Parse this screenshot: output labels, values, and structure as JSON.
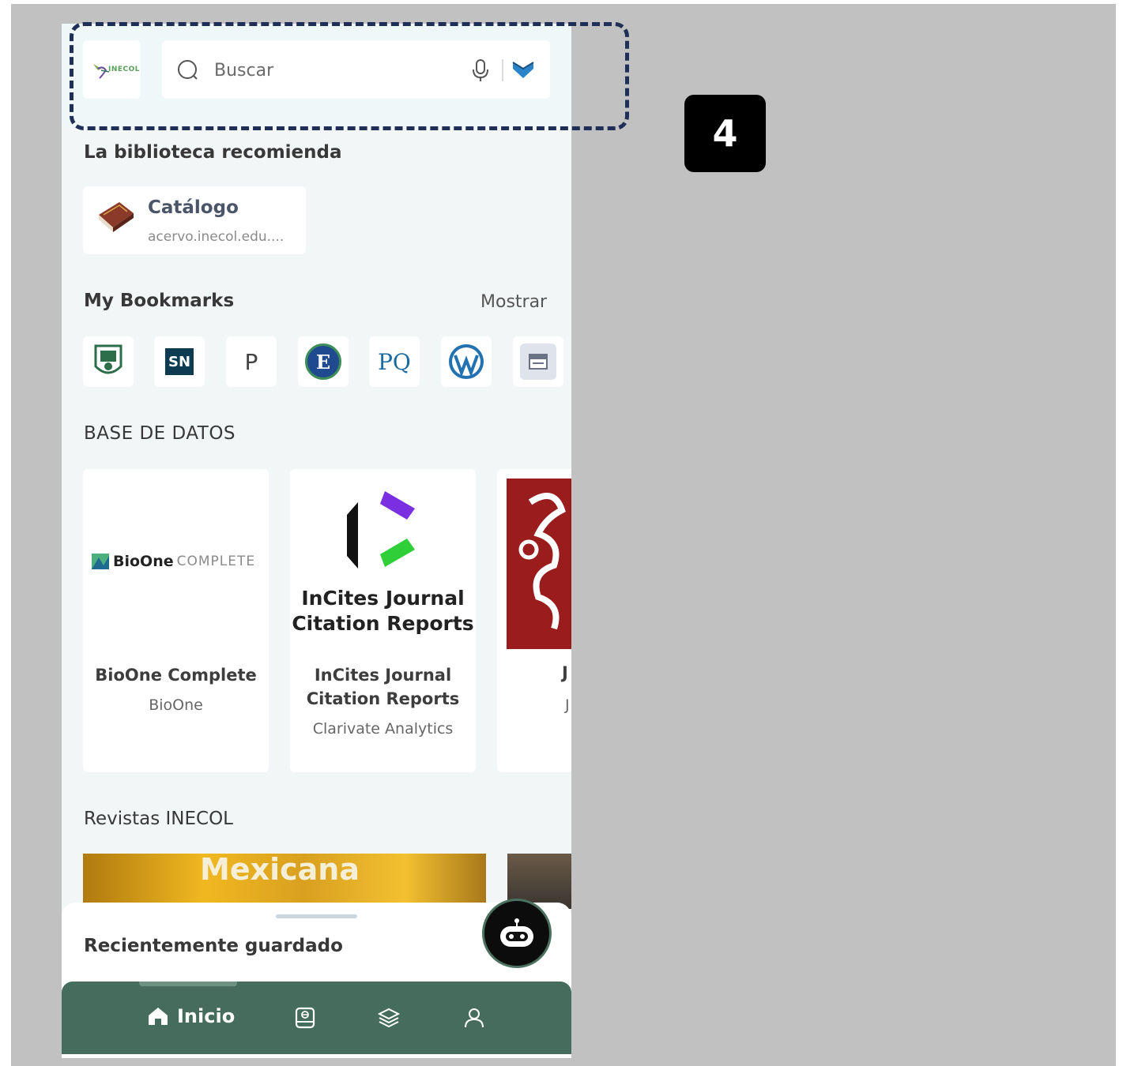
{
  "header": {
    "logo_text": "INECOL",
    "search_placeholder": "Buscar"
  },
  "recommend": {
    "title": "La biblioteca recomienda",
    "card": {
      "title": "Catálogo",
      "url": "acervo.inecol.edu...."
    }
  },
  "bookmarks": {
    "title": "My Bookmarks",
    "show_label": "Mostrar",
    "items": [
      {
        "icon": "inecol-seal-icon"
      },
      {
        "icon": "springer-nature-icon",
        "text": "SN"
      },
      {
        "icon": "p-letter-icon",
        "text": "P"
      },
      {
        "icon": "e-circle-icon",
        "text": "E"
      },
      {
        "icon": "proquest-icon",
        "text": "PQ"
      },
      {
        "icon": "wordpress-icon"
      },
      {
        "icon": "calendar-icon"
      }
    ]
  },
  "databases": {
    "title": "BASE DE DATOS",
    "items": [
      {
        "logo_brand": "BioOne",
        "logo_suffix": "COMPLETE",
        "name": "BioOne Complete",
        "provider": "BioOne"
      },
      {
        "logo_line1": "InCites Journal",
        "logo_line2": "Citation Reports",
        "name_line1": "InCites Journal",
        "name_line2": "Citation Reports",
        "provider": "Clarivate Analytics"
      },
      {
        "name": "J",
        "provider": "J"
      }
    ]
  },
  "journals": {
    "title": "Revistas INECOL",
    "banner_text": "Mexicana"
  },
  "sheet": {
    "title": "Recientemente guardado"
  },
  "nav": {
    "home_label": "Inicio",
    "items": [
      "home-icon",
      "ebook-icon",
      "layers-icon",
      "profile-icon"
    ]
  },
  "annotation": {
    "step": "4"
  },
  "colors": {
    "nav_bg": "#456c5c",
    "highlight_border": "#1f2f57",
    "badge_bg": "#000000"
  }
}
